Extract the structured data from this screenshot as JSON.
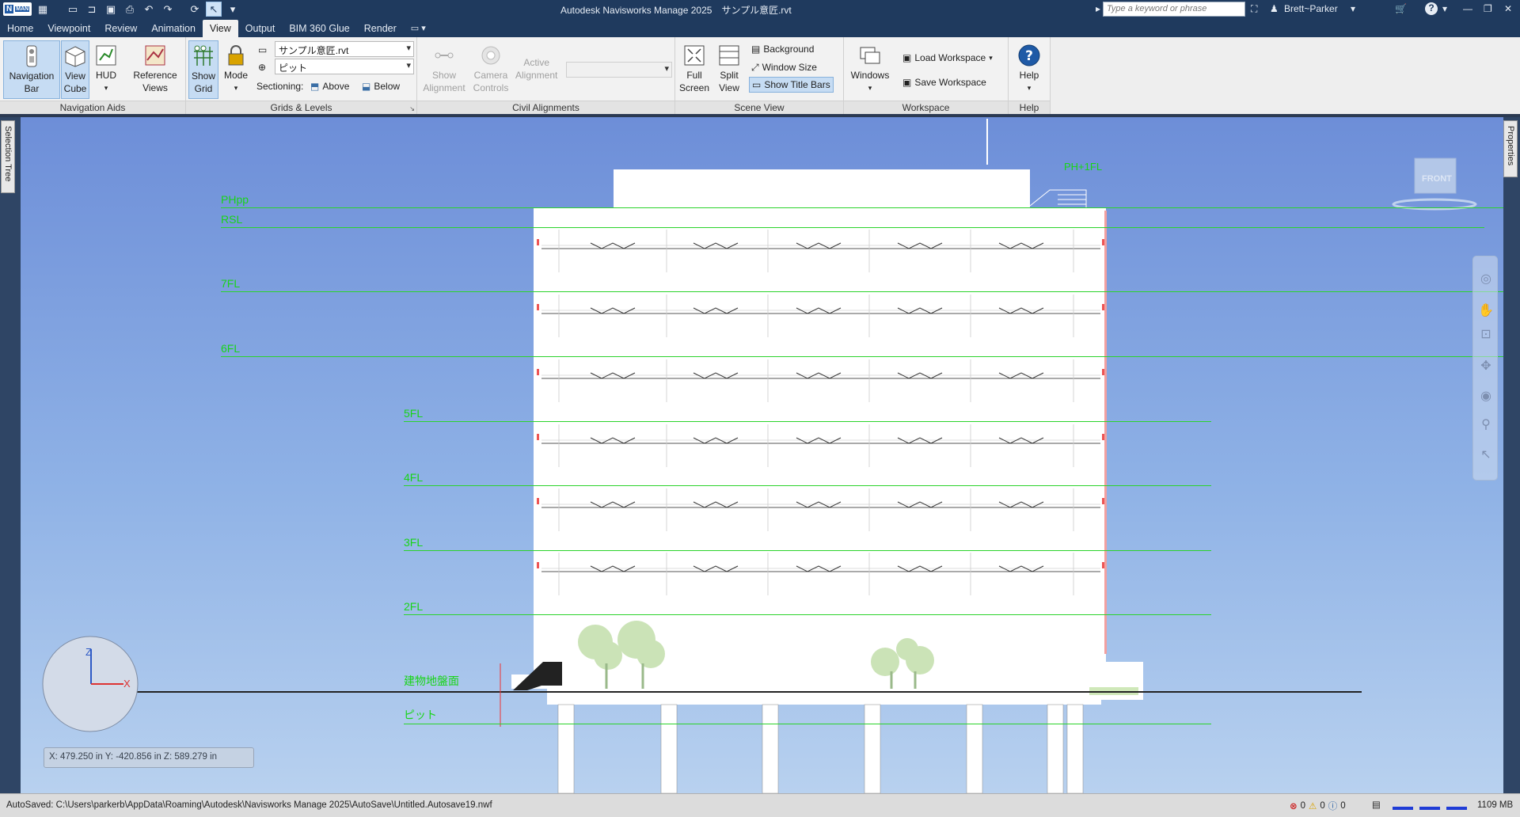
{
  "app": {
    "title": "Autodesk Navisworks Manage 2025　サンプル意匠.rvt",
    "logo_letter": "N",
    "logo_badge": "MAN",
    "search_placeholder": "Type a keyword or phrase",
    "user_name": "Brett~Parker",
    "help_label": "?"
  },
  "tabs": [
    "Home",
    "Viewpoint",
    "Review",
    "Animation",
    "View",
    "Output",
    "BIM 360 Glue",
    "Render"
  ],
  "active_tab": "View",
  "ribbon": {
    "navigation_aids": {
      "title": "Navigation Aids",
      "navigation_bar": "Navigation\nBar",
      "view_cube": "View\nCube",
      "hud": "HUD",
      "reference_views": "Reference\nViews"
    },
    "grids_levels": {
      "title": "Grids & Levels",
      "show_grid": "Show\nGrid",
      "mode": "Mode",
      "model_combo": "サンプル意匠.rvt",
      "level_combo": "ピット",
      "sectioning_label": "Sectioning:",
      "above": "Above",
      "below": "Below"
    },
    "civil_alignments": {
      "title": "Civil Alignments",
      "show_alignment": "Show\nAlignment",
      "camera_controls": "Camera\nControls",
      "active_alignment": "Active\nAlignment"
    },
    "scene_view": {
      "title": "Scene View",
      "full_screen": "Full\nScreen",
      "split_view": "Split\nView",
      "background": "Background",
      "window_size": "Window Size",
      "show_title_bars": "Show Title Bars"
    },
    "workspace": {
      "title": "Workspace",
      "windows": "Windows",
      "load_workspace": "Load Workspace",
      "save_workspace": "Save Workspace"
    },
    "help": {
      "title": "Help",
      "help": "Help"
    }
  },
  "docks": {
    "left_tab": "Selection Tree",
    "right_tab": "Properties"
  },
  "viewport": {
    "viewcube_face": "FRONT",
    "levels": [
      {
        "name": "PHpp"
      },
      {
        "name": "RSL"
      },
      {
        "name": "7FL"
      },
      {
        "name": "6FL"
      },
      {
        "name": "5FL"
      },
      {
        "name": "4FL"
      },
      {
        "name": "3FL"
      },
      {
        "name": "2FL"
      },
      {
        "name": "建物地盤面"
      },
      {
        "name": "ピット"
      }
    ],
    "roof_label": "PH+1FL",
    "coordinates": "X: 479.250 in   Y: -420.856 in   Z: 589.279 in",
    "gizmo": {
      "z": "Z",
      "x": "X"
    }
  },
  "status": {
    "autosave_path": "AutoSaved: C:\\Users\\parkerb\\AppData\\Roaming\\Autodesk\\Navisworks Manage 2025\\AutoSave\\Untitled.Autosave19.nwf",
    "errors": "0",
    "warnings": "0",
    "info": "0",
    "memory": "1109 MB"
  }
}
